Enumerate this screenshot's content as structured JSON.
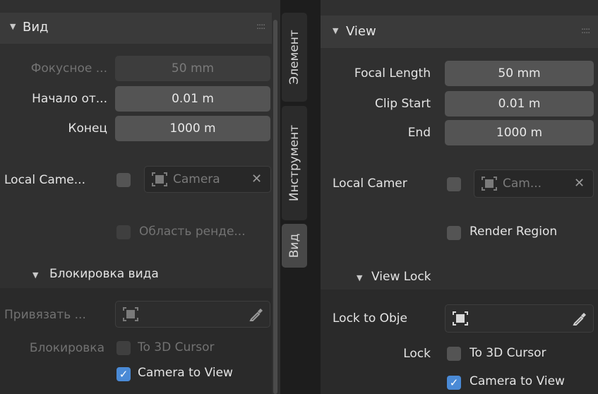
{
  "left": {
    "header": {
      "title": "Вид",
      "grip": "::::"
    },
    "focal": {
      "label": "Фокусное ...",
      "value": "50 mm"
    },
    "clip_start": {
      "label": "Начало от...",
      "value": "0.01 m"
    },
    "clip_end": {
      "label": "Конец",
      "value": "1000 m"
    },
    "local_camera": {
      "label": "Local Came...",
      "value": "Camera",
      "clear": "✕"
    },
    "render_region": {
      "label": "Область ренде..."
    },
    "view_lock": {
      "title": "Блокировка вида"
    },
    "lock_object": {
      "label": "Привязать ..."
    },
    "lock": {
      "label": "Блокировка",
      "to_cursor": "To 3D Cursor",
      "camera_to_view": "Camera to View"
    },
    "tabs": [
      "Элемент",
      "Инструмент",
      "Вид"
    ]
  },
  "right": {
    "header": {
      "title": "View",
      "grip": "::::"
    },
    "focal": {
      "label": "Focal Length",
      "value": "50 mm"
    },
    "clip_start": {
      "label": "Clip Start",
      "value": "0.01 m"
    },
    "clip_end": {
      "label": "End",
      "value": "1000 m"
    },
    "local_camera": {
      "label": "Local Camer",
      "value": "Cam...",
      "clear": "✕"
    },
    "render_region": {
      "label": "Render Region"
    },
    "view_lock": {
      "title": "View Lock"
    },
    "lock_object": {
      "label": "Lock to Obje"
    },
    "lock": {
      "label": "Lock",
      "to_cursor": "To 3D Cursor",
      "camera_to_view": "Camera to View"
    }
  },
  "checkmark": "✓",
  "triangle": "▼",
  "colors": {
    "panel": "#303030",
    "header": "#3a3a3a",
    "field": "#545454",
    "accent": "#4a8ad6",
    "background": "#1d1d1d"
  }
}
